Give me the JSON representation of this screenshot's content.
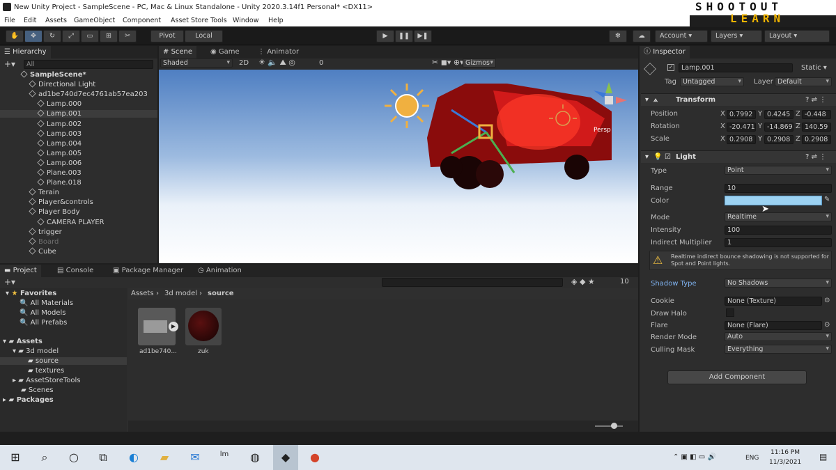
{
  "window": {
    "title": "New Unity Project - SampleScene - PC, Mac & Linux Standalone - Unity 2020.3.14f1 Personal* <DX11>"
  },
  "logo": {
    "line1": "SHOOTOUT",
    "line2": "LEARN"
  },
  "menu": [
    "File",
    "Edit",
    "Assets",
    "GameObject",
    "Component",
    "Asset Store Tools",
    "Window",
    "Help"
  ],
  "toolbar": {
    "pivot": "Pivot",
    "local": "Local",
    "account": "Account",
    "layers": "Layers",
    "layout": "Layout"
  },
  "hierarchy": {
    "tab": "Hierarchy",
    "search_placeholder": "All",
    "items": [
      {
        "label": "SampleScene*",
        "depth": 0
      },
      {
        "label": "Directional Light",
        "depth": 1
      },
      {
        "label": "ad1be740d7ec4761ab57ea203",
        "depth": 1
      },
      {
        "label": "Lamp.000",
        "depth": 2
      },
      {
        "label": "Lamp.001",
        "depth": 2
      },
      {
        "label": "Lamp.002",
        "depth": 2
      },
      {
        "label": "Lamp.003",
        "depth": 2
      },
      {
        "label": "Lamp.004",
        "depth": 2
      },
      {
        "label": "Lamp.005",
        "depth": 2
      },
      {
        "label": "Lamp.006",
        "depth": 2
      },
      {
        "label": "Plane.003",
        "depth": 2
      },
      {
        "label": "Plane.018",
        "depth": 2
      },
      {
        "label": "Terain",
        "depth": 1
      },
      {
        "label": "Player&controls",
        "depth": 1
      },
      {
        "label": "Player Body",
        "depth": 1
      },
      {
        "label": "CAMERA PLAYER",
        "depth": 2
      },
      {
        "label": "trigger",
        "depth": 1
      },
      {
        "label": "Board",
        "depth": 1
      },
      {
        "label": "Cube",
        "depth": 1
      }
    ],
    "selected_index": 4
  },
  "scene": {
    "tabs": [
      "Scene",
      "Game",
      "Animator"
    ],
    "shading": "Shaded",
    "mode2d": "2D",
    "layers_count": "0",
    "gizmos": "Gizmos",
    "persp": "Persp"
  },
  "project": {
    "tabs": [
      "Project",
      "Console",
      "Package Manager",
      "Animation"
    ],
    "favorites": {
      "label": "Favorites",
      "items": [
        "All Materials",
        "All Models",
        "All Prefabs"
      ]
    },
    "assets": {
      "label": "Assets",
      "items": [
        {
          "label": "3d model",
          "depth": 1
        },
        {
          "label": "source",
          "depth": 2
        },
        {
          "label": "textures",
          "depth": 2
        },
        {
          "label": "AssetStoreTools",
          "depth": 1
        },
        {
          "label": "Scenes",
          "depth": 1
        }
      ]
    },
    "packages": "Packages",
    "breadcrumb": [
      "Assets",
      "3d model",
      "source"
    ],
    "files": [
      {
        "label": "ad1be740..."
      },
      {
        "label": "zuk"
      }
    ],
    "hidden_count": "10"
  },
  "inspector": {
    "tab": "Inspector",
    "object_name": "Lamp.001",
    "static": "Static",
    "tag_label": "Tag",
    "tag_value": "Untagged",
    "layer_label": "Layer",
    "layer_value": "Default",
    "transform": {
      "title": "Transform",
      "rows": [
        {
          "label": "Position",
          "x": "0.7992",
          "y": "0.4245",
          "z": "-0.448"
        },
        {
          "label": "Rotation",
          "x": "-20.471",
          "y": "-14.869",
          "z": "140.59"
        },
        {
          "label": "Scale",
          "x": "0.2908",
          "y": "0.2908",
          "z": "0.2908"
        }
      ]
    },
    "light": {
      "title": "Light",
      "type_label": "Type",
      "type_value": "Point",
      "range_label": "Range",
      "range_value": "10",
      "color_label": "Color",
      "color_hex": "#9cd2f2",
      "mode_label": "Mode",
      "mode_value": "Realtime",
      "intensity_label": "Intensity",
      "intensity_value": "100",
      "indirect_label": "Indirect Multiplier",
      "indirect_value": "1",
      "warning": "Realtime indirect bounce shadowing is not supported for Spot and Point lights.",
      "shadow_label": "Shadow Type",
      "shadow_value": "No Shadows",
      "cookie_label": "Cookie",
      "cookie_value": "None (Texture)",
      "halo_label": "Draw Halo",
      "flare_label": "Flare",
      "flare_value": "None (Flare)",
      "render_label": "Render Mode",
      "render_value": "Auto",
      "culling_label": "Culling Mask",
      "culling_value": "Everything"
    },
    "add_component": "Add Component"
  },
  "taskbar": {
    "lang": "ENG",
    "time": "11:16 PM",
    "date": "11/3/2021"
  },
  "colors": {
    "accent": "#3a79d8",
    "sky_top": "#4f7fc2",
    "ground": "#ffffff",
    "selection": "#3c3c3c"
  }
}
